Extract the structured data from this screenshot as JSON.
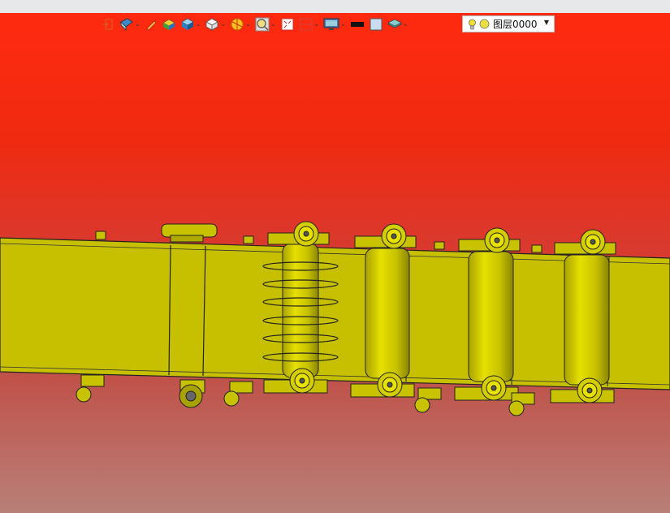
{
  "toolbar": {
    "icons": [
      {
        "name": "exit-view-icon",
        "dropdown": false
      },
      {
        "name": "view-orientation-icon",
        "dropdown": true
      },
      {
        "name": "pencil-icon",
        "dropdown": false
      },
      {
        "name": "render-solid-icon",
        "dropdown": false
      },
      {
        "name": "shaded-cube-icon",
        "dropdown": true
      },
      {
        "name": "wireframe-cube-icon",
        "dropdown": true
      },
      {
        "name": "section-icon",
        "dropdown": true
      },
      {
        "name": "zoom-search-icon",
        "dropdown": true
      },
      {
        "name": "fit-view-icon",
        "dropdown": false
      },
      {
        "name": "split-view-icon",
        "dropdown": true
      },
      {
        "name": "display-monitor-icon",
        "dropdown": true
      },
      {
        "name": "line-color-swatch",
        "dropdown": false
      },
      {
        "name": "fill-color-swatch",
        "dropdown": false
      },
      {
        "name": "layers-stack-icon",
        "dropdown": true
      }
    ],
    "line_color": "#111111",
    "fill_color": "#c9ddf0"
  },
  "layer_dropdown": {
    "name": "图层0000",
    "bulb_color": "#f2e030",
    "dot_color": "#e8e040"
  },
  "colors": {
    "model_yellow": "#c8c200",
    "background_top": "#ff2a10",
    "background_bottom": "#b88078"
  }
}
